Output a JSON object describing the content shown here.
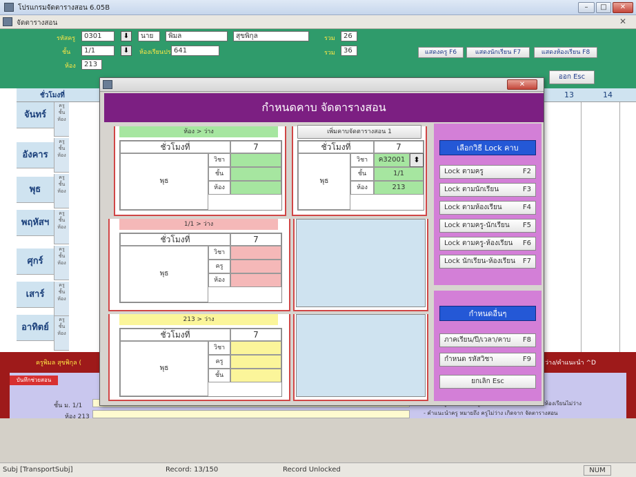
{
  "app": {
    "title": "โปรแกรมจัดตารางสอน 6.05B",
    "subwindow_title": "จัดตารางสอน",
    "status": {
      "field": "Subj [TransportSubj]",
      "record": "Record: 13/150",
      "lock": "Record Unlocked",
      "num": "NUM"
    }
  },
  "header": {
    "labels": {
      "teacher_code": "รหัสครู",
      "class": "ชั้น",
      "room": "ห้อง",
      "prefix": "นาย",
      "homeroom": "ห้องเรียนประจำ",
      "total": "รวม"
    },
    "teacher_code": "0301",
    "class_value": "1/1",
    "room_value": "213",
    "first_name": "พิมล",
    "last_name": "สุขพิกุล",
    "homeroom_value": "641",
    "total_1": "26",
    "total_2": "36",
    "buttons": {
      "show_teacher": "แสดงครู F6",
      "show_student": "แสดงนักเรียน F7",
      "show_room": "แสดงห้องเรียน F8",
      "exit": "ออก Esc"
    }
  },
  "timetable": {
    "period_label": "ชั่วโมงที่",
    "col_13": "13",
    "col_14": "14",
    "sub_labels": [
      "ครู",
      "ชั้น",
      "ห้อง"
    ],
    "days": [
      "จันทร์",
      "อังคาร",
      "พุธ",
      "พฤหัสฯ",
      "ศุกร์",
      "เสาร์",
      "อาทิตย์"
    ]
  },
  "bottom": {
    "teacher_line": "ครูพิมล สุขพิกุล (",
    "assign_label": "บันทึกช่วยสอน",
    "class_label": "ชั้น ม. 1/1",
    "room_label": "ห้อง 213",
    "right_header": "ว่าง/คำแนะนำ ^D",
    "note1": "- ตีเส้นครูไม่ว่าง/ห้องครู+นักเรียนไม่ว่าง/ห้องห้อง+ห้องเรียนไม่ว่าง",
    "note2": "- คำแนะนำครู หมายถึง ครูไม่ว่าง เกิดจาก จัดตารางสอน"
  },
  "modal": {
    "header": "กำหนดคาบ จัดตารางสอน",
    "panel1": {
      "tag": "ห้อง > ว่าง",
      "period_label": "ชั่วโมงที่",
      "period": "7",
      "day": "พุธ",
      "rows": [
        "วิชา",
        "ชั้น",
        "ห้อง"
      ]
    },
    "panel2": {
      "button": "เพิ่มคาบจัดตารางสอน 1",
      "period_label": "ชั่วโมงที่",
      "period": "7",
      "day": "พุธ",
      "rows": [
        "วิชา",
        "ชั้น",
        "ห้อง"
      ],
      "values": [
        "ค32001",
        "1/1",
        "213"
      ]
    },
    "panel3": {
      "tag": "1/1 > ว่าง",
      "period_label": "ชั่วโมงที่",
      "period": "7",
      "day": "พุธ",
      "rows": [
        "วิชา",
        "ครู",
        "ห้อง"
      ]
    },
    "panel4": {
      "tag": "213 > ว่าง",
      "period_label": "ชั่วโมงที่",
      "period": "7",
      "day": "พุธ",
      "rows": [
        "วิชา",
        "ครู",
        "ชั้น"
      ]
    },
    "lock_title": "เลือกวิธี Lock คาบ",
    "lock_buttons": [
      {
        "label": "Lock ตามครู",
        "key": "F2"
      },
      {
        "label": "Lock ตามนักเรียน",
        "key": "F3"
      },
      {
        "label": "Lock ตามห้องเรียน",
        "key": "F4"
      },
      {
        "label": "Lock ตามครู-นักเรียน",
        "key": "F5"
      },
      {
        "label": "Lock ตามครู-ห้องเรียน",
        "key": "F6"
      },
      {
        "label": "Lock นักเรียน-ห้องเรียน",
        "key": "F7"
      }
    ],
    "other_title": "กำหนดอื่นๆ",
    "other_buttons": [
      {
        "label": "ภาคเรียน/ปี/เวลา/คาบ",
        "key": "F8"
      },
      {
        "label": "กำหนด รหัสวิชา",
        "key": "F9"
      }
    ],
    "cancel": "ยกเลิก Esc"
  }
}
